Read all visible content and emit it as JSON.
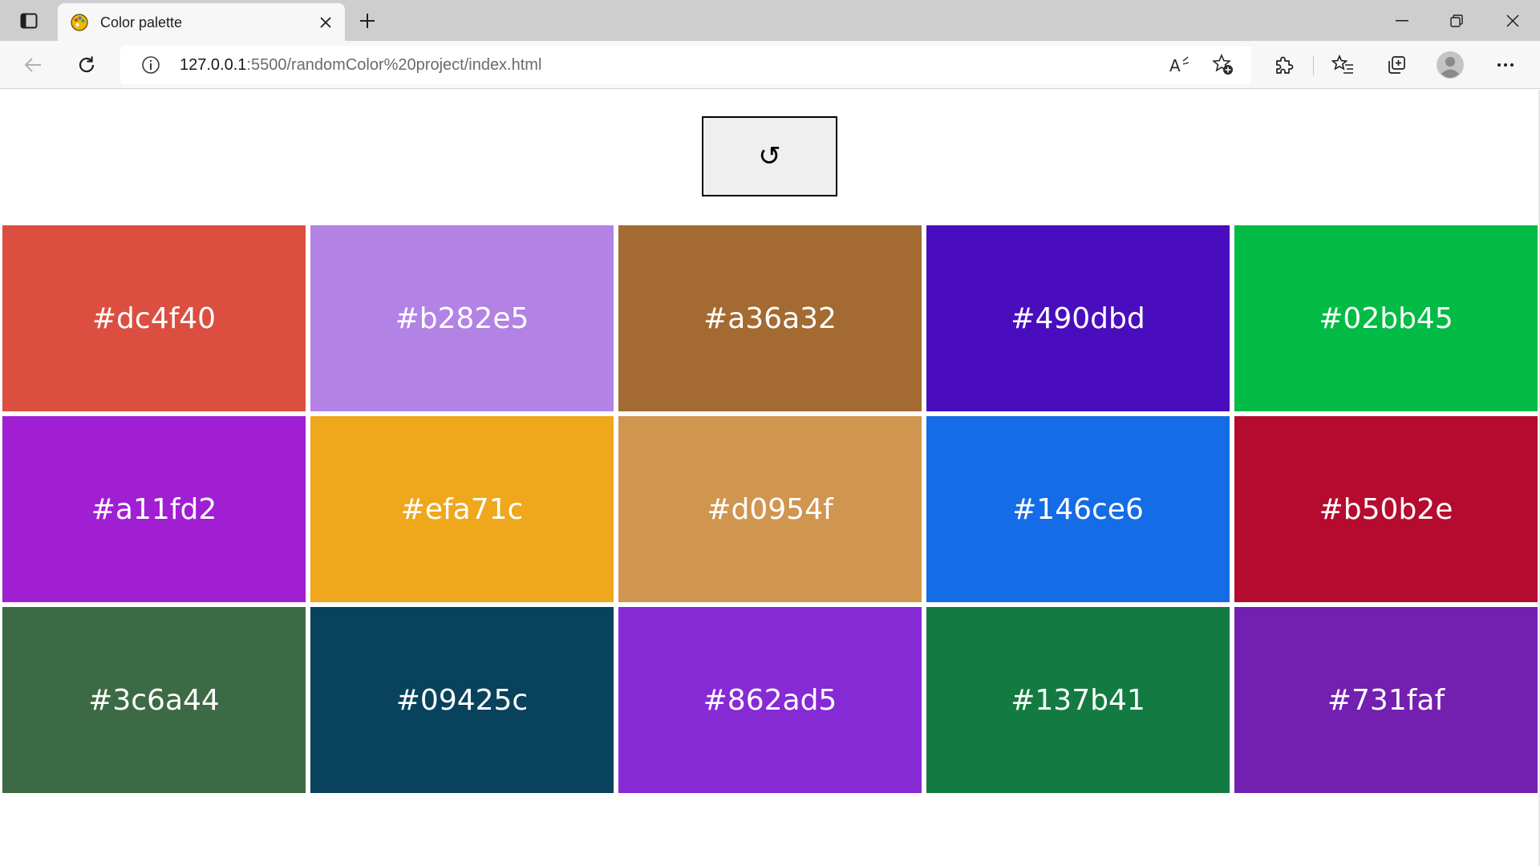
{
  "browser": {
    "tab": {
      "title": "Color palette"
    },
    "address": {
      "host": "127.0.0.1",
      "path": ":5500/randomColor%20project/index.html"
    },
    "icons": {
      "tab_actions": "tab-actions-icon",
      "favicon": "palette-icon",
      "close": "close-icon",
      "new_tab": "plus-icon",
      "minimize": "minimize-icon",
      "restore": "restore-icon",
      "window_close": "close-icon",
      "back": "back-arrow-icon",
      "reload": "reload-icon",
      "site_info": "info-icon",
      "read_aloud": "read-aloud-icon",
      "add_favorite": "star-add-icon",
      "extensions": "puzzle-icon",
      "favorites": "favorites-icon",
      "collections": "collections-icon",
      "profile": "avatar-icon",
      "menu": "more-icon"
    }
  },
  "app": {
    "refresh_label": "↺",
    "swatches": [
      {
        "hex": "#dc4f40",
        "label": "#dc4f40"
      },
      {
        "hex": "#b282e5",
        "label": "#b282e5"
      },
      {
        "hex": "#a36a32",
        "label": "#a36a32"
      },
      {
        "hex": "#490dbd",
        "label": "#490dbd"
      },
      {
        "hex": "#02bb45",
        "label": "#02bb45"
      },
      {
        "hex": "#a11fd2",
        "label": "#a11fd2"
      },
      {
        "hex": "#efa71c",
        "label": "#efa71c"
      },
      {
        "hex": "#d0954f",
        "label": "#d0954f"
      },
      {
        "hex": "#146ce6",
        "label": "#146ce6"
      },
      {
        "hex": "#b50b2e",
        "label": "#b50b2e"
      },
      {
        "hex": "#3c6a44",
        "label": "#3c6a44"
      },
      {
        "hex": "#09425c",
        "label": "#09425c"
      },
      {
        "hex": "#862ad5",
        "label": "#862ad5"
      },
      {
        "hex": "#137b41",
        "label": "#137b41"
      },
      {
        "hex": "#731faf",
        "label": "#731faf"
      }
    ]
  }
}
